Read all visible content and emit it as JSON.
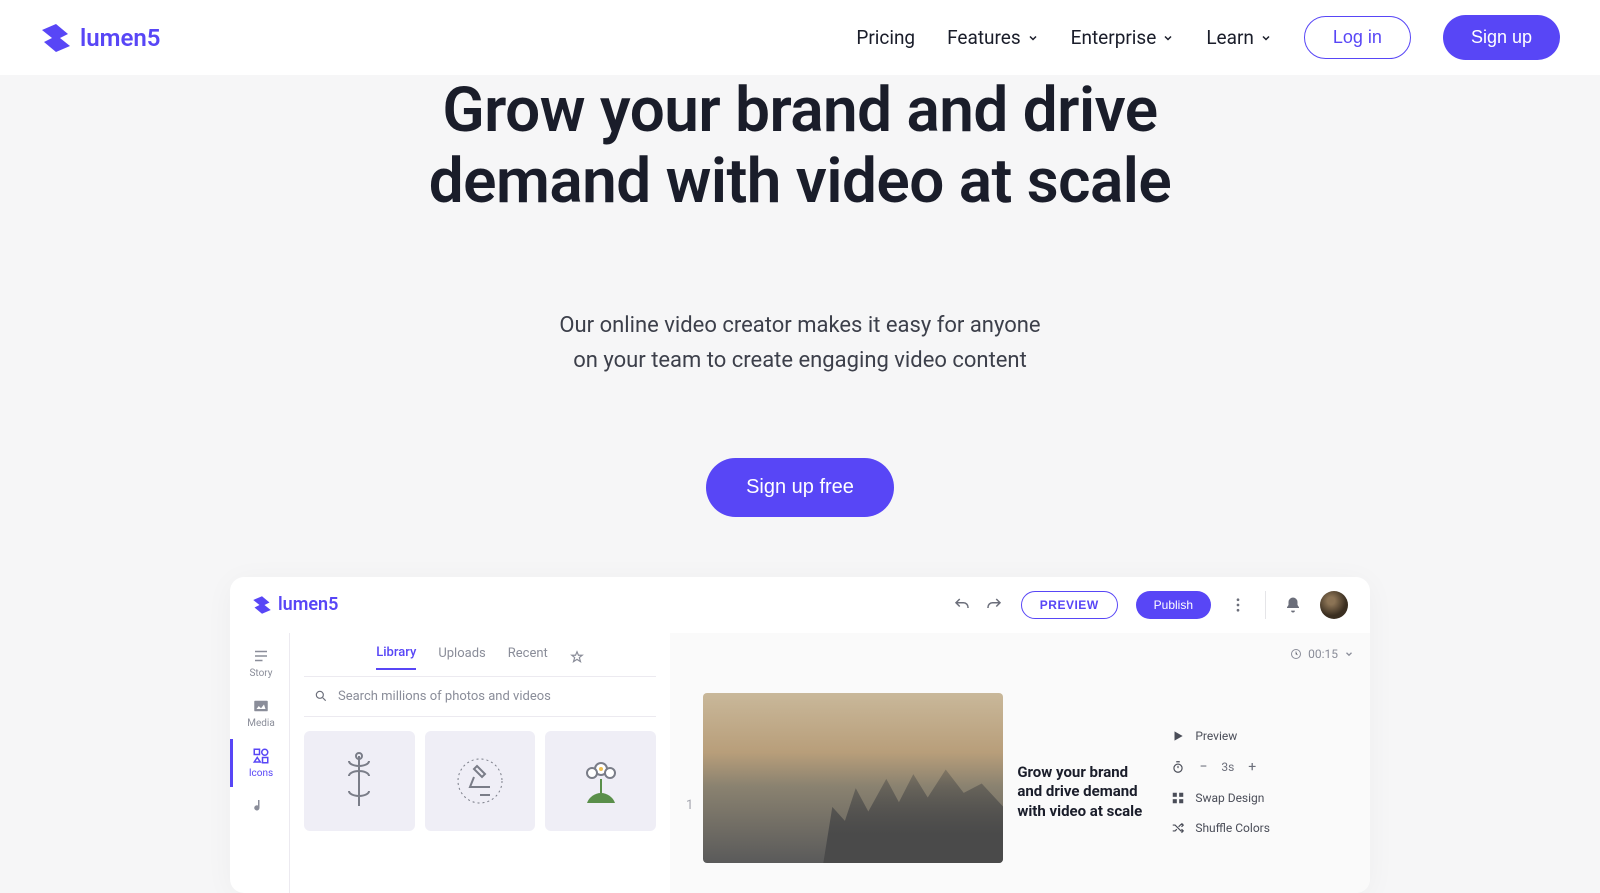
{
  "header": {
    "brand": "lumen5",
    "nav": {
      "pricing": "Pricing",
      "features": "Features",
      "enterprise": "Enterprise",
      "learn": "Learn"
    },
    "login": "Log in",
    "signup": "Sign up"
  },
  "hero": {
    "title": "Grow your brand and drive demand with video at scale",
    "sub_line1": "Our online video creator makes it easy for anyone",
    "sub_line2": "on your team to create engaging video content",
    "cta": "Sign up free"
  },
  "preview": {
    "brand": "lumen5",
    "preview_btn": "PREVIEW",
    "publish_btn": "Publish",
    "sidebar": {
      "story": "Story",
      "media": "Media",
      "icons": "Icons",
      "music": ""
    },
    "library": {
      "tabs": {
        "library": "Library",
        "uploads": "Uploads",
        "recent": "Recent"
      },
      "search_placeholder": "Search millions of photos and videos"
    },
    "timecode": "00:15",
    "slide_number": "1",
    "slide_caption": "Grow your brand and drive demand with video at scale",
    "panel": {
      "preview": "Preview",
      "duration_value": "3s",
      "swap": "Swap Design",
      "shuffle": "Shuffle Colors"
    }
  }
}
